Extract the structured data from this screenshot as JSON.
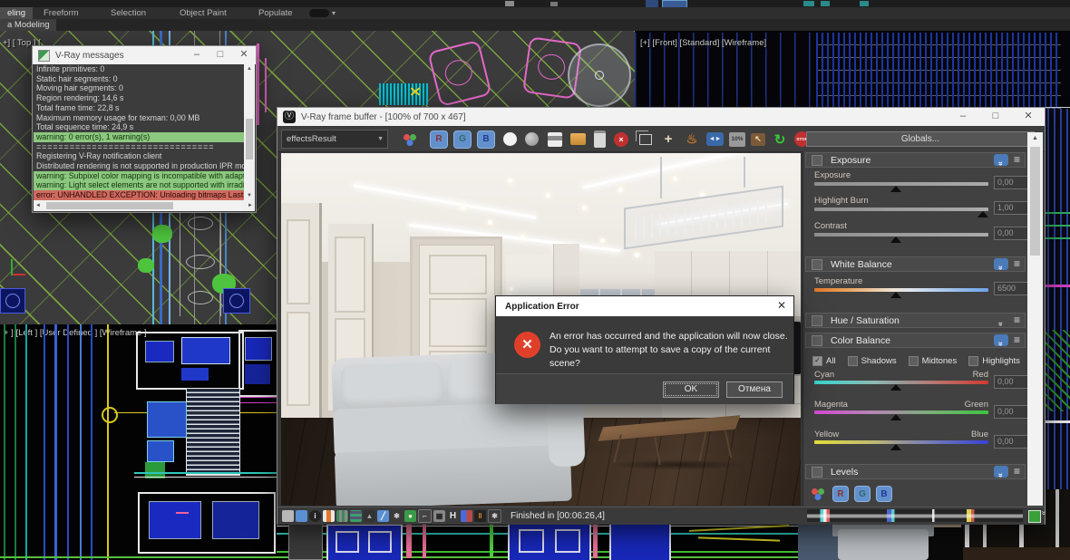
{
  "ribbon": {
    "tabs": [
      {
        "label": "eling",
        "active": true
      },
      {
        "label": "Freeform",
        "active": false
      },
      {
        "label": "Selection",
        "active": false
      },
      {
        "label": "Object Paint",
        "active": false
      },
      {
        "label": "Populate",
        "active": false
      }
    ],
    "subtab": "a Modeling"
  },
  "viewports": {
    "top_label": "+] [ Top ] [",
    "front_label": "[+] [Front] [Standard] [Wireframe]",
    "left_label": "+ ] [Left ] [User Defined ] [Wireframe ]"
  },
  "vray_messages": {
    "title": "V-Ray messages",
    "lines": [
      {
        "text": "Infinite primitives: 0",
        "type": "normal"
      },
      {
        "text": "Static hair segments: 0",
        "type": "normal"
      },
      {
        "text": "Moving hair segments: 0",
        "type": "normal"
      },
      {
        "text": "Region rendering: 14,6 s",
        "type": "normal"
      },
      {
        "text": "Total frame time: 22,8 s",
        "type": "normal"
      },
      {
        "text": "Maximum memory usage for texman: 0,00 MB",
        "type": "normal"
      },
      {
        "text": "Total sequence time: 24,9 s",
        "type": "normal"
      },
      {
        "text": "warning: 0 error(s), 1 warning(s)",
        "type": "warning"
      },
      {
        "text": "================================",
        "type": "separator"
      },
      {
        "text": "Registering V-Ray notification client",
        "type": "normal"
      },
      {
        "text": "Distributed rendering is not supported in production IPR mod",
        "type": "normal"
      },
      {
        "text": "warning: Subpixel color mapping is incompatible with adaptiv",
        "type": "warning"
      },
      {
        "text": "warning: Light select elements are not supported with irradia",
        "type": "warning"
      },
      {
        "text": "error: UNHANDLED EXCEPTION: Unloading bitmaps Last m",
        "type": "error"
      }
    ]
  },
  "frame_buffer": {
    "title": "V-Ray frame buffer - [100% of 700 x 467]",
    "channel_dropdown": "effectsResult",
    "globals_button": "Globals...",
    "status_text": "Finished in [00:06:26,4]",
    "rgb_buttons": [
      "R",
      "G",
      "B"
    ],
    "zoom_icon_label": "10%",
    "stop_icon_label": "STOP",
    "h_icon_label": "H",
    "toolbar_icon_names": [
      "rgb-channels-icon",
      "red-channel-icon",
      "green-channel-icon",
      "blue-channel-icon",
      "alpha-channel-icon",
      "monochrome-icon",
      "save-image-icon",
      "load-image-icon",
      "copy-clipboard-icon",
      "clear-image-icon",
      "duplicate-buffer-icon",
      "track-mouse-icon",
      "render-last-icon",
      "compare-ab-icon",
      "zoom-level-icon",
      "region-render-icon",
      "ipr-refresh-icon",
      "stop-render-icon",
      "render-teapot-icon"
    ],
    "bottom_icon_names": [
      "save-icon",
      "save-channels-icon",
      "info-icon",
      "layers-icon",
      "composite-icon",
      "grid-icon",
      "histogram-icon",
      "pencil-icon",
      "effects-icon",
      "image-icon",
      "curve-icon",
      "lut-icon",
      "h-letter-icon",
      "ab-split-icon",
      "bars-icon",
      "asterisk-icon"
    ],
    "panel": {
      "exposure": {
        "title": "Exposure",
        "rows": [
          {
            "label": "Exposure",
            "value": "0,00"
          },
          {
            "label": "Highlight Burn",
            "value": "1,00"
          },
          {
            "label": "Contrast",
            "value": "0,00"
          }
        ]
      },
      "white_balance": {
        "title": "White Balance",
        "rows": [
          {
            "label": "Temperature",
            "value": "6500"
          }
        ]
      },
      "hue_saturation": {
        "title": "Hue / Saturation"
      },
      "color_balance": {
        "title": "Color Balance",
        "modes": [
          {
            "label": "All",
            "checked": true
          },
          {
            "label": "Shadows",
            "checked": false
          },
          {
            "label": "Midtones",
            "checked": false
          },
          {
            "label": "Highlights",
            "checked": false
          }
        ],
        "rows": [
          {
            "left": "Cyan",
            "right": "Red",
            "value": "0,00"
          },
          {
            "left": "Magenta",
            "right": "Green",
            "value": "0,00"
          },
          {
            "left": "Yellow",
            "right": "Blue",
            "value": "0,00"
          }
        ]
      },
      "levels": {
        "title": "Levels",
        "rgb_buttons": [
          "R",
          "G",
          "B"
        ]
      }
    }
  },
  "error_dialog": {
    "title": "Application Error",
    "line1": "An error has occurred and the application will now close.",
    "line2": "Do you want to attempt to save a copy of the current scene?",
    "ok_label": "OK",
    "cancel_label": "Отмена"
  },
  "colors": {
    "accent_blue": "#6290cc",
    "warning_green": "#8cc87f",
    "error_red": "#cf6a5f",
    "hatch_green": "#85b63e",
    "dialog_icon_red": "#e0402a"
  }
}
